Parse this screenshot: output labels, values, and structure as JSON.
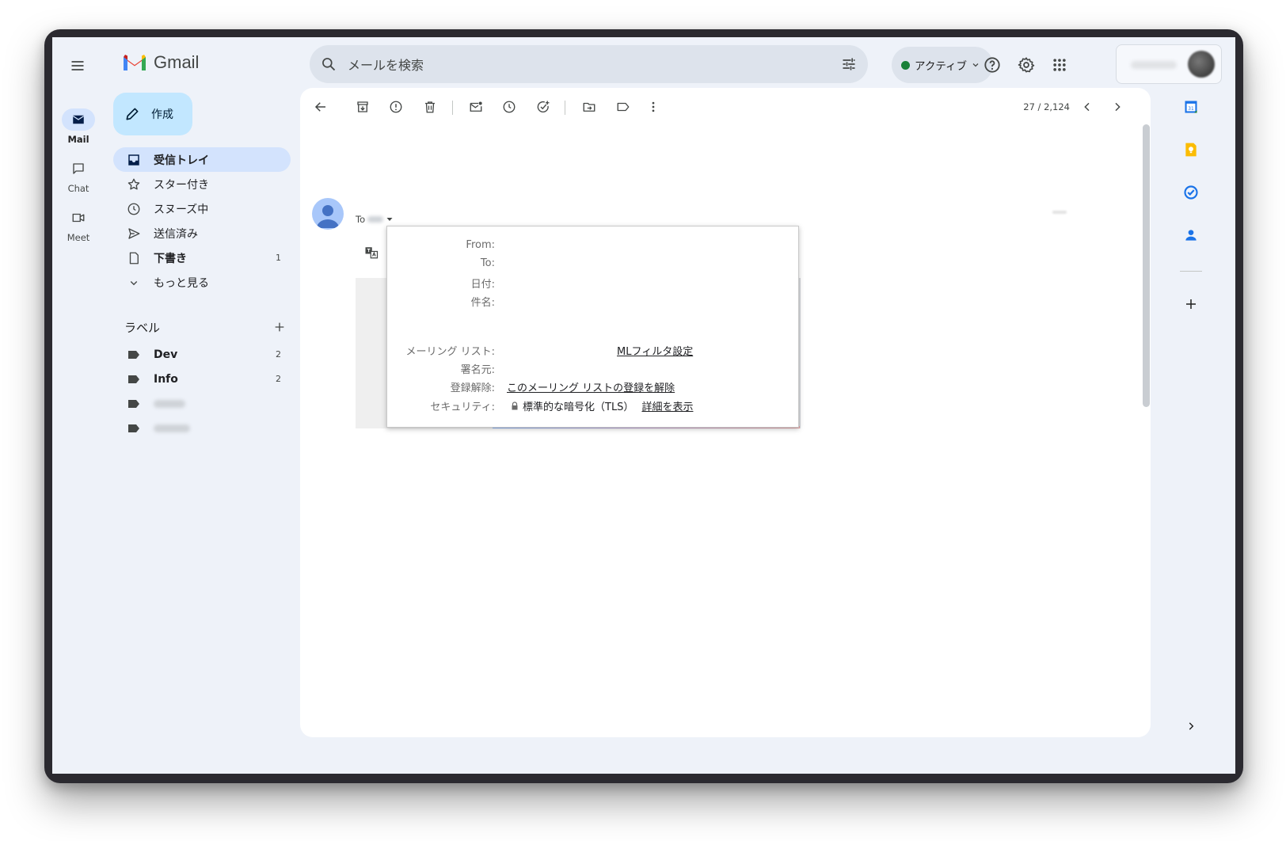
{
  "app": {
    "name": "Gmail"
  },
  "search": {
    "placeholder": "メールを検索"
  },
  "status": {
    "label": "アクティブ",
    "color": "#188038"
  },
  "rail": [
    {
      "label": "Mail",
      "icon": "mail-icon"
    },
    {
      "label": "Chat",
      "icon": "chat-icon"
    },
    {
      "label": "Meet",
      "icon": "video-icon"
    }
  ],
  "compose": {
    "label": "作成"
  },
  "nav": [
    {
      "label": "受信トレイ",
      "icon": "inbox-icon",
      "count": ""
    },
    {
      "label": "スター付き",
      "icon": "star-icon",
      "count": ""
    },
    {
      "label": "スヌーズ中",
      "icon": "clock-icon",
      "count": ""
    },
    {
      "label": "送信済み",
      "icon": "send-icon",
      "count": ""
    },
    {
      "label": "下書き",
      "icon": "draft-icon",
      "count": "1"
    },
    {
      "label": "もっと見る",
      "icon": "chevron-down-icon",
      "count": ""
    }
  ],
  "labels": {
    "heading": "ラベル",
    "items": [
      {
        "label": "Dev",
        "count": "2"
      },
      {
        "label": "Info",
        "count": "2"
      }
    ]
  },
  "toolbar": {
    "pager": "27 / 2,124"
  },
  "message": {
    "to_prefix": "To"
  },
  "details_popup": {
    "rows": [
      {
        "label": "From:",
        "value": "",
        "link": ""
      },
      {
        "label": "To:",
        "value": "",
        "link": ""
      },
      {
        "label": "日付:",
        "value": "",
        "link": ""
      },
      {
        "label": "件名:",
        "value": "",
        "link": ""
      },
      {
        "label": "メーリング リスト:",
        "value": "",
        "link": "MLフィルタ設定"
      },
      {
        "label": "署名元:",
        "value": "",
        "link": ""
      },
      {
        "label": "登録解除:",
        "value": "",
        "link": "このメーリング リストの登録を解除"
      },
      {
        "label": "セキュリティ:",
        "value": "標準的な暗号化（TLS）",
        "link": "詳細を表示"
      }
    ]
  },
  "colors": {
    "compose_bg": "#c2e7ff",
    "selected_nav_bg": "#d3e3fd",
    "app_bg": "#eef2f9"
  }
}
